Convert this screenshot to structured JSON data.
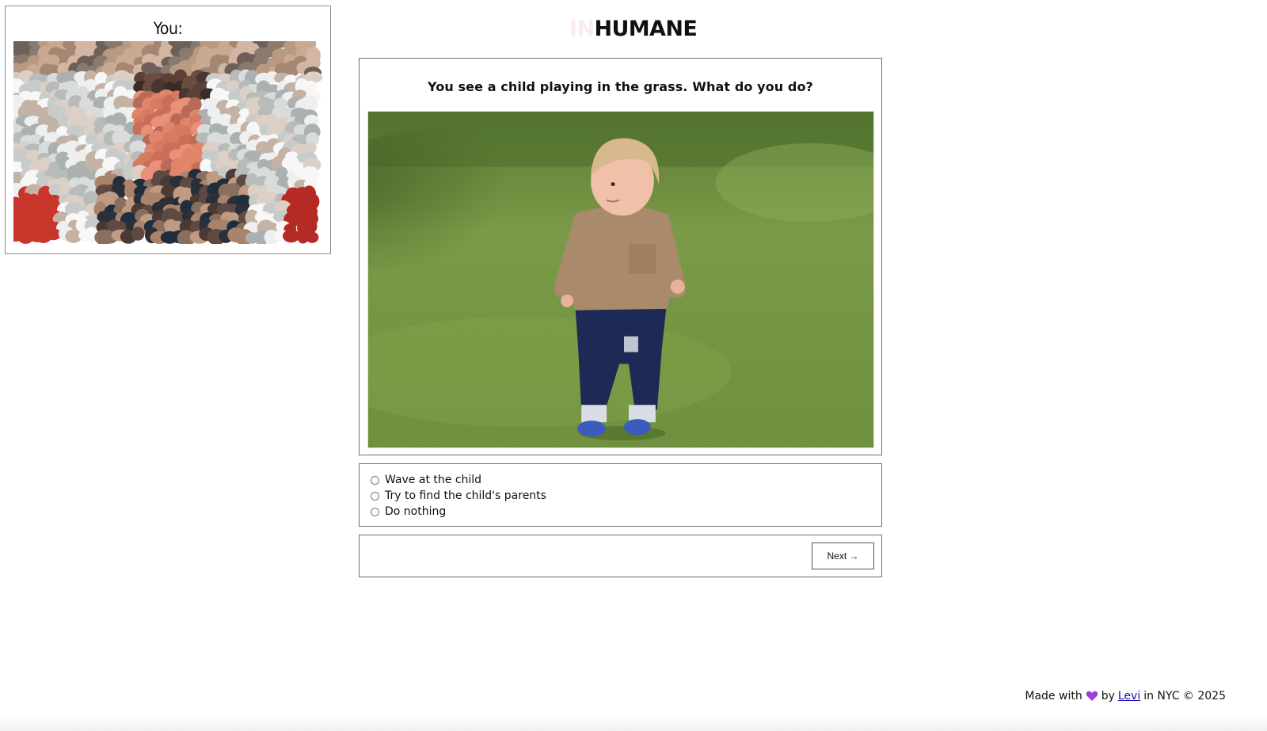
{
  "you_panel": {
    "title": "You:"
  },
  "brand": {
    "ghost_prefix": "IN",
    "title": "HUMANE"
  },
  "question": {
    "text": "You see a child playing in the grass. What do you do?"
  },
  "options": [
    {
      "label": "Wave at the child",
      "selected": false
    },
    {
      "label": "Try to find the child's parents",
      "selected": false
    },
    {
      "label": "Do nothing",
      "selected": false
    }
  ],
  "nav": {
    "next_label": "Next →"
  },
  "footer": {
    "made_with": "Made with",
    "by": "by",
    "author": "Levi",
    "location": "in NYC © 2025",
    "heart_color": "#9b3fd6"
  },
  "colors": {
    "grass": "#6f8f3c",
    "sweater": "#a98a6a",
    "jeans": "#1d2a55"
  },
  "icons": {
    "heart": "purple-heart-icon",
    "radio": "radio-button-icon",
    "arrow": "right-arrow"
  }
}
